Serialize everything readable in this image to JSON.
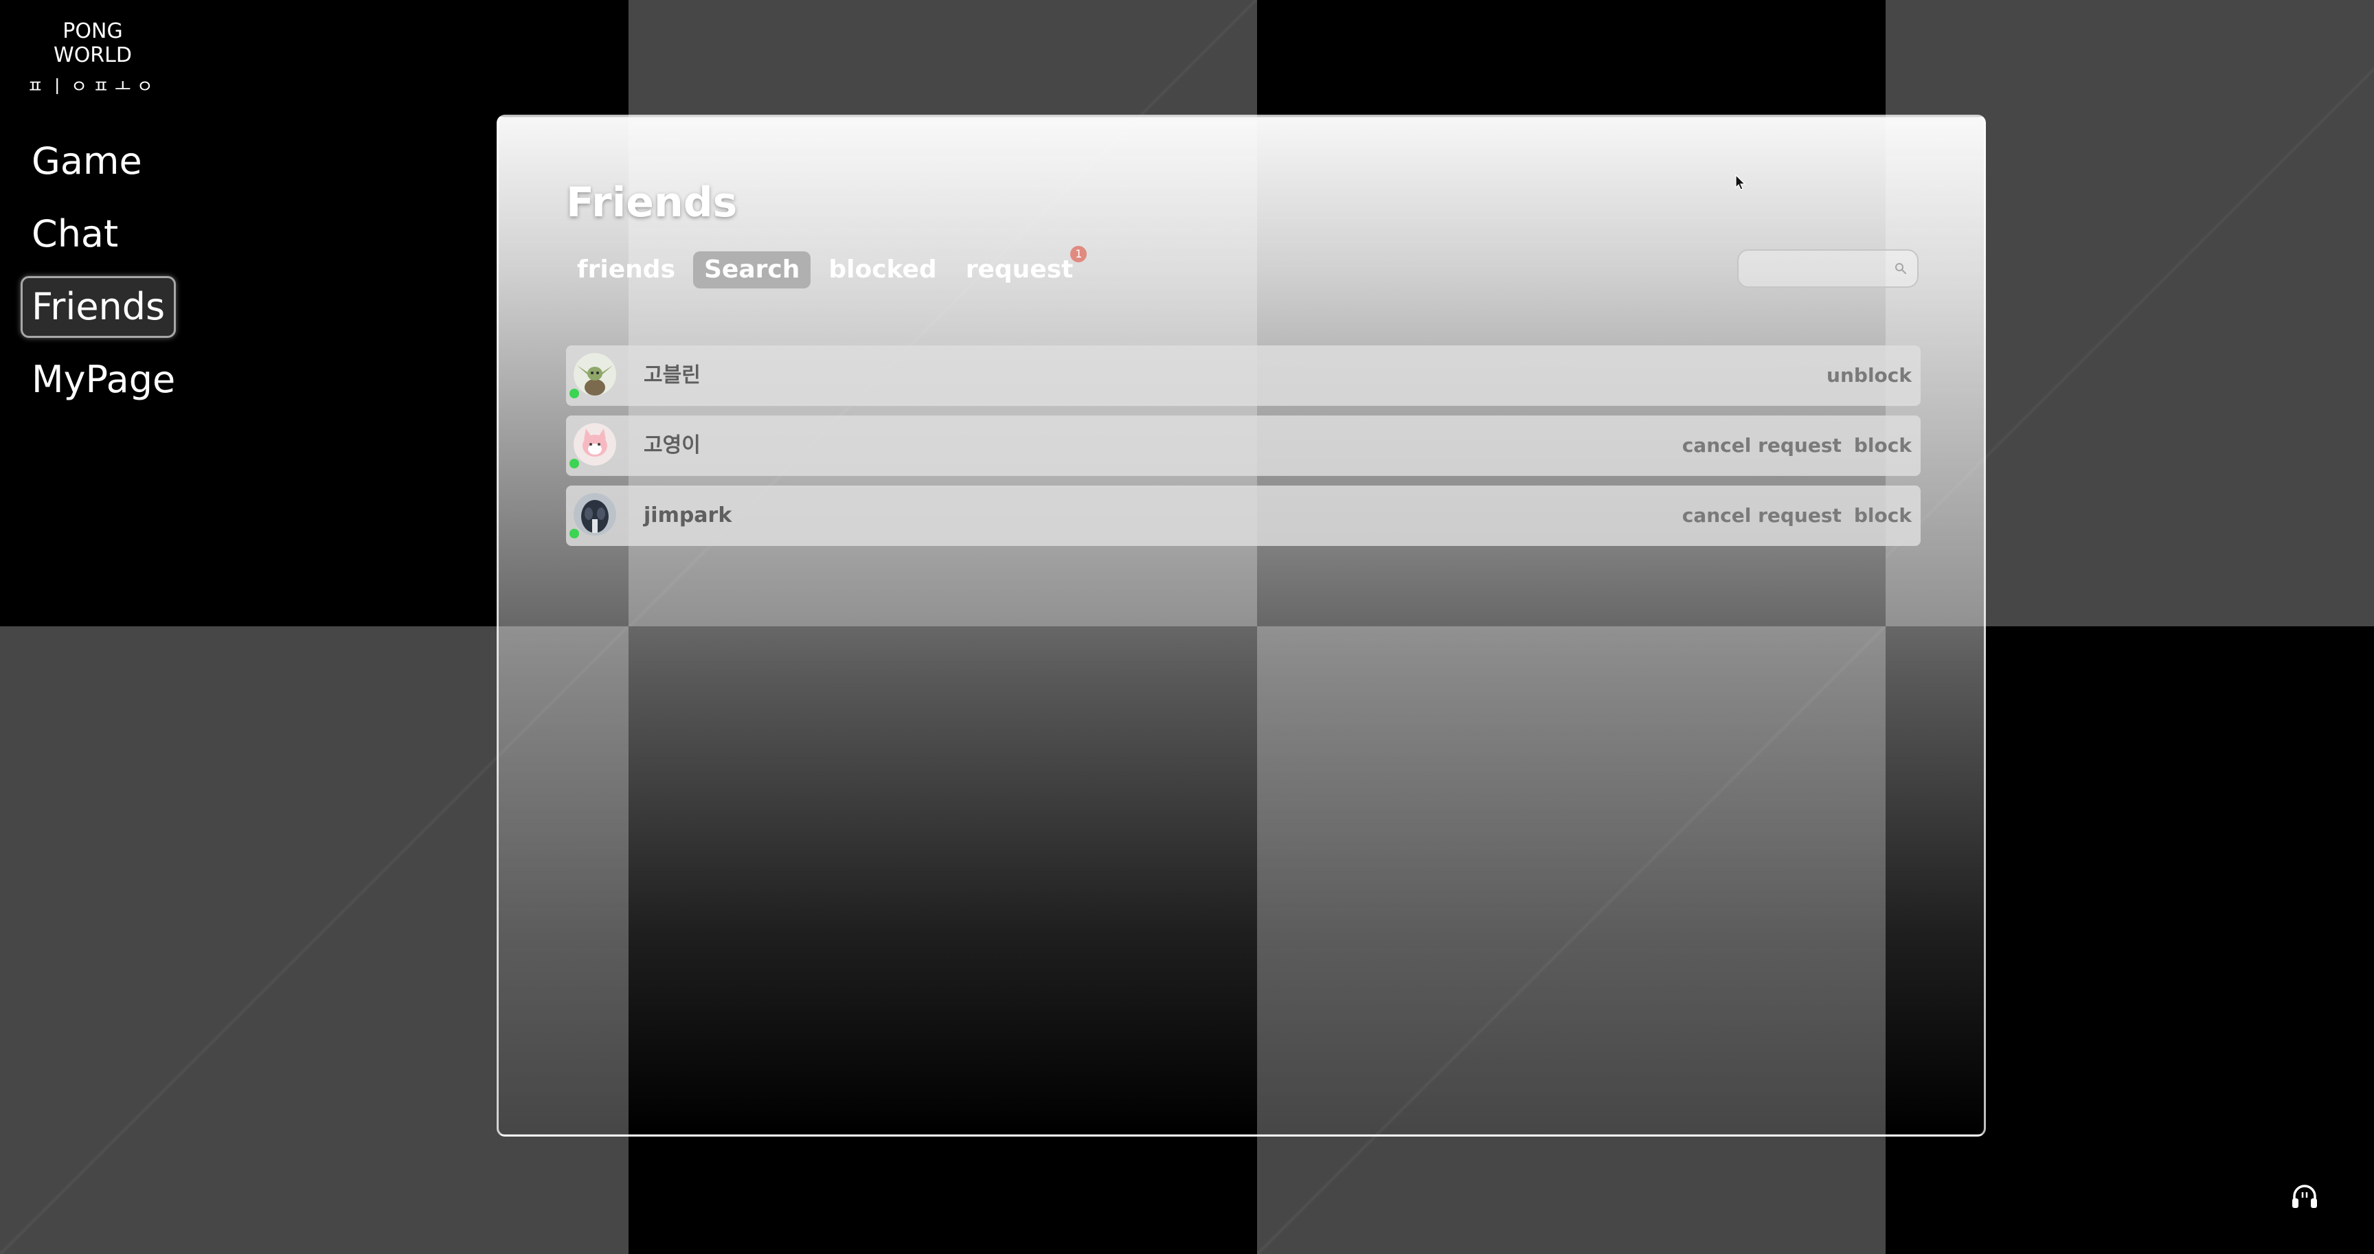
{
  "app": {
    "logo_title": "PONG WORLD",
    "logo_subtitle": "ㅍㅣㅇㅍㅗㅇ"
  },
  "nav": {
    "items": [
      {
        "label": "Game"
      },
      {
        "label": "Chat"
      },
      {
        "label": "Friends",
        "active": true
      },
      {
        "label": "MyPage"
      }
    ]
  },
  "panel": {
    "title": "Friends",
    "tabs": [
      {
        "label": "friends"
      },
      {
        "label": "Search",
        "active": true
      },
      {
        "label": "blocked"
      },
      {
        "label": "request",
        "badge": "1"
      }
    ],
    "search": {
      "value": "",
      "placeholder": "",
      "icon": "search-icon"
    },
    "users": [
      {
        "name": "고블린",
        "online": true,
        "avatar": "goblin-avatar",
        "actions": [
          "unblock"
        ]
      },
      {
        "name": "고영이",
        "online": true,
        "avatar": "cat-avatar",
        "actions": [
          "cancel request",
          "block"
        ]
      },
      {
        "name": "jimpark",
        "online": true,
        "avatar": "jimpark-avatar",
        "actions": [
          "cancel request",
          "block"
        ]
      }
    ]
  },
  "footer": {
    "audio_icon": "headphones-icon"
  },
  "colors": {
    "online_status": "#3cd452",
    "badge": "#e08a80",
    "active_tab": "#b0b0b0"
  }
}
